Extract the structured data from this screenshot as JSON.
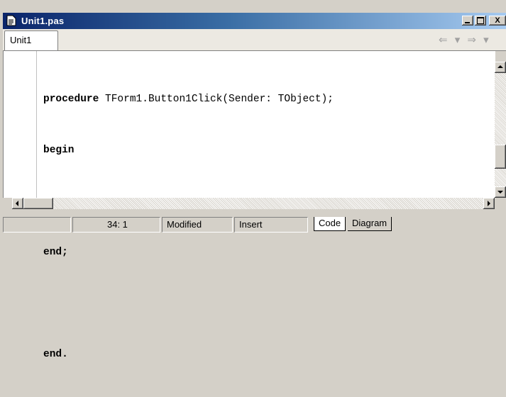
{
  "window": {
    "title": "Unit1.pas",
    "controls": {
      "minimize": "",
      "maximize": "",
      "close": "X"
    }
  },
  "tabs": [
    {
      "label": "Unit1"
    }
  ],
  "navigation": {
    "arrows_text": "⇐ ▾ ⇒ ▾"
  },
  "editor": {
    "lines": [
      {
        "keyword": "procedure",
        "rest": " TForm1.Button1Click(Sender: TObject);"
      },
      {
        "keyword": "begin",
        "rest": ""
      },
      {
        "keyword": "",
        "rest": ""
      },
      {
        "keyword": "end;",
        "rest": ""
      },
      {
        "keyword": "",
        "rest": ""
      },
      {
        "keyword": "end.",
        "rest": ""
      }
    ]
  },
  "status": {
    "position": "34:  1",
    "modified": "Modified",
    "insert_mode": "Insert",
    "view_tabs": [
      "Code",
      "Diagram"
    ]
  }
}
